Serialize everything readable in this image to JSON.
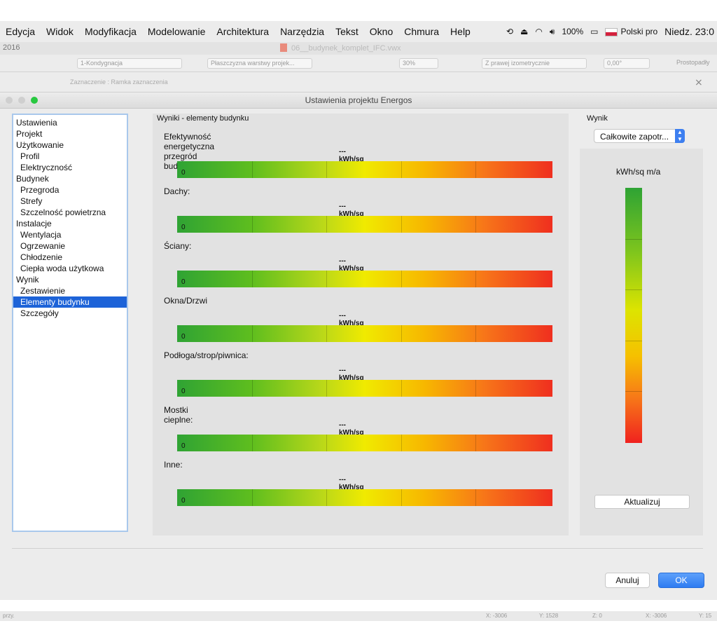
{
  "menubar": {
    "items": [
      "Edycja",
      "Widok",
      "Modyfikacja",
      "Modelowanie",
      "Architektura",
      "Narzędzia",
      "Tekst",
      "Okno",
      "Chmura",
      "Help"
    ],
    "battery": "100%",
    "language": "Polski pro",
    "clock": "Niedz. 23:0"
  },
  "app": {
    "year_label": "2016",
    "document_title": "06__budynek_komplet_IFC.vwx"
  },
  "toolbar": {
    "layer": "1-Kondygnacja",
    "plane": "Płaszczyzna warstwy projek...",
    "zoom": "30%",
    "view": "Z prawej izometrycznie",
    "angle": "0,00°",
    "projection": "Prostopadły"
  },
  "subbar": {
    "selection_mode": "Zaznaczenie : Ramka zaznaczenia"
  },
  "dialog": {
    "title": "Ustawienia projektu Energos",
    "tree": [
      {
        "label": "Ustawienia",
        "level": 0
      },
      {
        "label": "Projekt",
        "level": 0
      },
      {
        "label": "Użytkowanie",
        "level": 0
      },
      {
        "label": "Profil",
        "level": 1
      },
      {
        "label": "Elektryczność",
        "level": 1
      },
      {
        "label": "Budynek",
        "level": 0
      },
      {
        "label": "Przegroda",
        "level": 1
      },
      {
        "label": "Strefy",
        "level": 1
      },
      {
        "label": "Szczelność powietrzna",
        "level": 1
      },
      {
        "label": "Instalacje",
        "level": 0
      },
      {
        "label": "Wentylacja",
        "level": 1
      },
      {
        "label": "Ogrzewanie",
        "level": 1
      },
      {
        "label": "Chłodzenie",
        "level": 1
      },
      {
        "label": "Ciepła woda użytkowa",
        "level": 1
      },
      {
        "label": "Wynik",
        "level": 0
      },
      {
        "label": "Zestawienie",
        "level": 1
      },
      {
        "label": "Elementy budynku",
        "level": 1,
        "selected": true
      },
      {
        "label": "Szczegóły",
        "level": 1
      }
    ],
    "center_title": "Wyniki - elementy budynku",
    "metrics": [
      {
        "label": "Efektywność energetyczna przegród budowlanych:",
        "value": "---",
        "unit": "kWh/sq m/a",
        "min": "0"
      },
      {
        "label": "Dachy:",
        "value": "---",
        "unit": "kWh/sq m/a",
        "min": "0"
      },
      {
        "label": "Ściany:",
        "value": "---",
        "unit": "kWh/sq m/a",
        "min": "0"
      },
      {
        "label": "Okna/Drzwi",
        "value": "---",
        "unit": "kWh/sq m/a",
        "min": "0"
      },
      {
        "label": "Podłoga/strop/piwnica:",
        "value": "---",
        "unit": "kWh/sq m/a",
        "min": "0"
      },
      {
        "label": "Mostki cieplne:",
        "value": "---",
        "unit": "kWh/sq m/a",
        "min": "0"
      },
      {
        "label": "Inne:",
        "value": "---",
        "unit": "kWh/sq m/a",
        "min": "0"
      }
    ],
    "right": {
      "title": "Wynik",
      "select_value": "Całkowite zapotr...",
      "unit": "kWh/sq m/a",
      "update_label": "Aktualizuj"
    },
    "cancel_label": "Anuluj",
    "ok_label": "OK"
  },
  "statusbar": {
    "left": "przy.",
    "coords": [
      "X: -3006",
      "Y: 1528",
      "Z: 0",
      "X: -3006",
      "Y: 15"
    ]
  },
  "colors": {
    "selection": "#1d63d8",
    "ok_button": "#2e7cf1",
    "gradient": [
      "#2fa334",
      "#f0ea00",
      "#ef2f1f"
    ]
  }
}
